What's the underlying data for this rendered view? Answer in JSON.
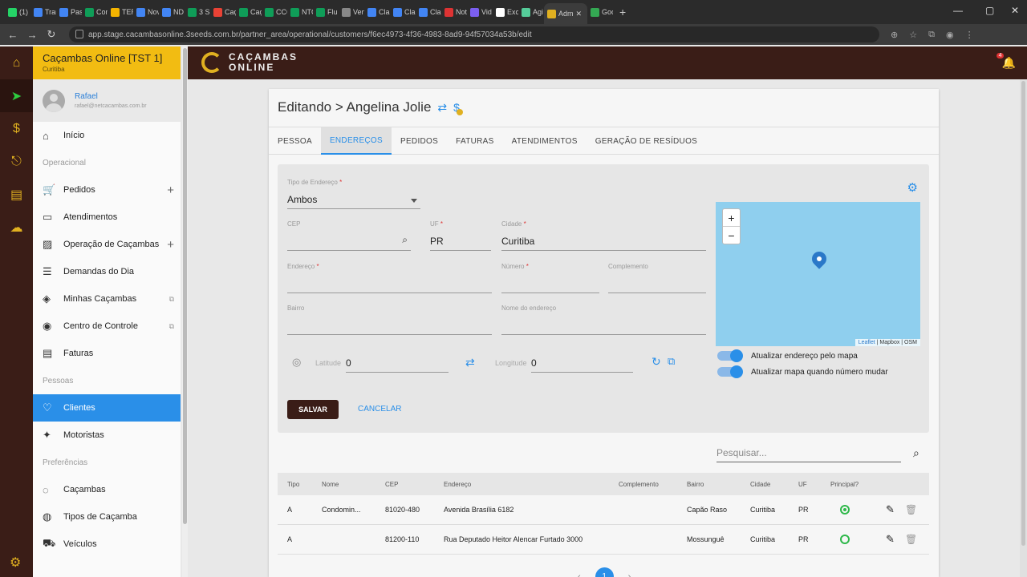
{
  "browser": {
    "tabs": [
      "(1)",
      "Tran",
      "Pas",
      "Con",
      "TER",
      "Nov",
      "ND",
      "3 S",
      "Caç",
      "Caç",
      "CCC",
      "NTC",
      "Flu",
      "Ven",
      "Clar",
      "Clar",
      "Clar",
      "Not",
      "Vid",
      "Exc",
      "Agi",
      "Adm",
      "Goo"
    ],
    "url": "app.stage.cacambasonline.3seeds.com.br/partner_area/operational/customers/f6ec4973-4f36-4983-8ad9-94f57034a53b/edit"
  },
  "sidebar": {
    "company": "Caçambas Online [TST 1]",
    "city": "Curitiba",
    "user_name": "Rafael",
    "user_email": "rafael@netcacambas.com.br",
    "items": [
      {
        "label": "Início",
        "icon": "home-icon",
        "glyph": "⌂"
      },
      {
        "section": "Operacional"
      },
      {
        "label": "Pedidos",
        "icon": "cart-icon",
        "glyph": "🛒",
        "plus": true
      },
      {
        "label": "Atendimentos",
        "icon": "label-icon",
        "glyph": "▭"
      },
      {
        "label": "Operação de Caçambas",
        "icon": "operation-icon",
        "glyph": "▨",
        "plus": true
      },
      {
        "label": "Demandas do Dia",
        "icon": "list-icon",
        "glyph": "☰"
      },
      {
        "label": "Minhas Caçambas",
        "icon": "layers-icon",
        "glyph": "◈",
        "ext": true
      },
      {
        "label": "Centro de Controle",
        "icon": "globe-icon",
        "glyph": "◉",
        "ext": true
      },
      {
        "label": "Faturas",
        "icon": "invoice-icon",
        "glyph": "▤"
      },
      {
        "section": "Pessoas"
      },
      {
        "label": "Clientes",
        "icon": "heart-icon",
        "glyph": "♡",
        "selected": true
      },
      {
        "label": "Motoristas",
        "icon": "runner-icon",
        "glyph": "✦"
      },
      {
        "section": "Preferências"
      },
      {
        "label": "Caçambas",
        "icon": "dumpster-icon",
        "glyph": "◌"
      },
      {
        "label": "Tipos de Caçamba",
        "icon": "dumpster-type-icon",
        "glyph": "◍"
      },
      {
        "label": "Veículos",
        "icon": "truck-icon",
        "glyph": "⛟"
      }
    ]
  },
  "header": {
    "logo_line1": "CAÇAMBAS",
    "logo_line2": "ONLINE",
    "notif_count": "4"
  },
  "page": {
    "title": "Editando > Angelina Jolie"
  },
  "tabs": [
    "PESSOA",
    "ENDEREÇOS",
    "PEDIDOS",
    "FATURAS",
    "ATENDIMENTOS",
    "GERAÇÃO DE RESÍDUOS"
  ],
  "form": {
    "tipo_label": "Tipo de Endereço",
    "tipo_value": "Ambos",
    "cep_label": "CEP",
    "cep_value": "",
    "uf_label": "UF",
    "uf_value": "PR",
    "cidade_label": "Cidade",
    "cidade_value": "Curitiba",
    "endereco_label": "Endereço",
    "numero_label": "Número",
    "complemento_label": "Complemento",
    "bairro_label": "Bairro",
    "nome_label": "Nome do endereço",
    "lat_label": "Latitude",
    "lat_value": "0",
    "lng_label": "Longitude",
    "lng_value": "0",
    "toggle1": "Atualizar endereço pelo mapa",
    "toggle2": "Atualizar mapa quando número mudar",
    "save": "SALVAR",
    "cancel": "CANCELAR",
    "required": "*"
  },
  "map": {
    "attr_leaflet": "Leaflet",
    "attr_rest": "| Mapbox | OSM",
    "zoom_in": "+",
    "zoom_out": "−"
  },
  "search": {
    "placeholder": "Pesquisar..."
  },
  "table": {
    "headers": [
      "Tipo",
      "Nome",
      "CEP",
      "Endereço",
      "Complemento",
      "Bairro",
      "Cidade",
      "UF",
      "Principal?"
    ],
    "rows": [
      {
        "tipo": "A",
        "nome": "Condomin...",
        "cep": "81020-480",
        "endereco": "Avenida Brasília 6182",
        "complemento": "",
        "bairro": "Capão Raso",
        "cidade": "Curitiba",
        "uf": "PR",
        "principal": true
      },
      {
        "tipo": "A",
        "nome": "",
        "cep": "81200-110",
        "endereco": "Rua Deputado Heitor Alencar Furtado 3000",
        "complemento": "",
        "bairro": "Mossunguê",
        "cidade": "Curitiba",
        "uf": "PR",
        "principal": false
      }
    ]
  },
  "pager": {
    "page": "1"
  }
}
